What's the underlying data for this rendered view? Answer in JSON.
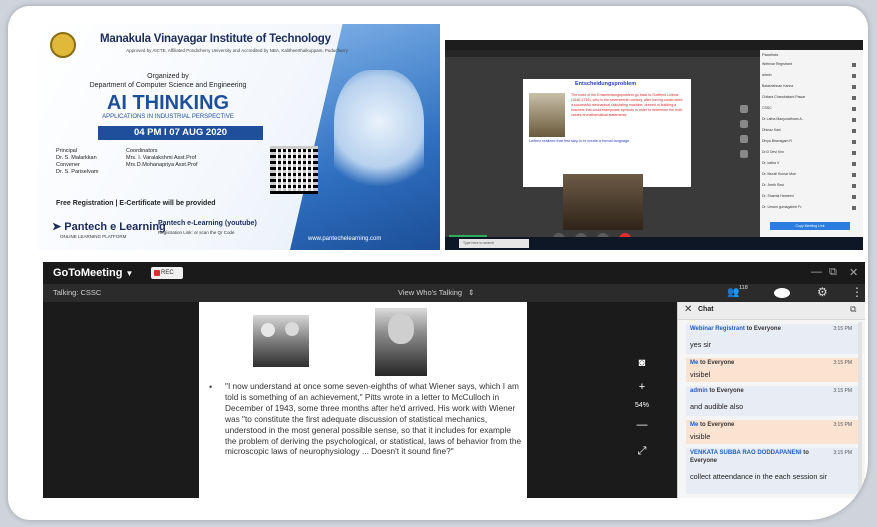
{
  "poster": {
    "institute": "Manakula Vinayagar Institute of Technology",
    "institute_sub": "Approved by AICTE, Affiliated Pondicherry University and Accredited by NBA, Kalitheerthalkuppam, Puducherry",
    "organized_by": "Organized by",
    "department": "Department of Computer Science and Engineering",
    "title": "AI THINKING",
    "subtitle": "APPLICATIONS IN INDUSTRIAL PERSPECTIVE",
    "date": "04 PM I 07 AUG 2020",
    "roles": [
      "Principal",
      "Dr. S. Malarkkan",
      "Convener",
      "Dr. S. Pariselvam"
    ],
    "coordinators_label": "Coordinators",
    "coordinators": [
      "Mrs. I. Varalakshmi Asst.Prof",
      "Mrs.D.Mohanapriya Asst.Prof"
    ],
    "free_reg": "Free Registration | E-Certificate will be provided",
    "pantech": "Pantech e Learning",
    "pantech_sub": "ONLINE LEARNING PLATFORM",
    "pantech_yt": "Pantech e-Learning (youtube)",
    "pantech_yt_sub": "Registration Link: or scan the Qr Code",
    "website": "www.pantechelearning.com"
  },
  "small_meeting": {
    "slide_title": "Entscheidungsproblem",
    "slide_text": "The roots of the Entscheidungsproblem go back to Gottfried Leibniz (1646-1716), who in the seventeenth century, after having constructed a successful mechanical calculating machine, dreamt of building a machine that could manipulate symbols in order to determine the truth values of mathematical statements.",
    "slide_text2": "Leibniz realized that first step is to create a formal language",
    "panel_head": "Panelists",
    "participants": [
      "Webinar Registrant",
      "admin",
      "Balakrishnan Kanna",
      "Chitara Chandrakant Pawar",
      "CSSC",
      "Dr Latha Manjunathram A..",
      "Dhinaz Kani",
      "Divya Bhavagam R",
      "Dr.D Devi Kim",
      "Dr. katha V",
      "Dr. Murali Kumar Moe",
      "Dr. Jeeth Ravi",
      "Dr. Shamla Hameed",
      "Dr. Umam gumagabhri Fr."
    ],
    "panel_button": "Copy Meeting Link",
    "task_search": "Type here to search"
  },
  "big_meeting": {
    "app_name": "GoToMeeting",
    "rec_label": "REC",
    "talking": "Talking: CSSC",
    "view_label": "View Who's Talking",
    "attendee_count": "118",
    "zoom": "54%",
    "quote": "\"I now understand at once some seven-eighths of what Wiener says, which I am told is something of an achievement,\" Pitts wrote in a letter to McCulloch in December of 1943, some three months after he'd arrived. His work with Wiener was \"to constitute the first adequate discussion of statistical mechanics, understood in the most general possible sense, so that it includes for example the problem of deriving the psychological, or statistical, laws of behavior from the microscopic laws of neurophysiology ... Doesn't it sound fine?\""
  },
  "chat": {
    "title": "Chat",
    "messages": [
      {
        "sender": "Webinar Registrant",
        "to": "to Everyone",
        "time": "3:15 PM",
        "text": "yes sir",
        "dir": "in"
      },
      {
        "sender": "Me",
        "to": "to Everyone",
        "time": "3:15 PM",
        "text": "visibel",
        "dir": "out"
      },
      {
        "sender": "admin",
        "to": "to Everyone",
        "time": "3:15 PM",
        "text": "and audible also",
        "dir": "in"
      },
      {
        "sender": "Me",
        "to": "to Everyone",
        "time": "3:15 PM",
        "text": "visible",
        "dir": "out"
      },
      {
        "sender": "VENKATA SUBBA RAO DODDAPANENI",
        "to": "to Everyone",
        "time": "3:15 PM",
        "text": "collect atteendance in the each session sir",
        "dir": "in"
      }
    ]
  },
  "colors": {
    "accent": "#1f4f9a",
    "rec": "#e02d2d",
    "chat_in": "#e8ecf4",
    "chat_out": "#fbe3d2"
  },
  "icons": [
    "camera-icon",
    "plus-icon",
    "minus-icon",
    "fullscreen-icon",
    "people-icon",
    "gear-icon",
    "more-icon",
    "close-icon",
    "popout-icon"
  ]
}
